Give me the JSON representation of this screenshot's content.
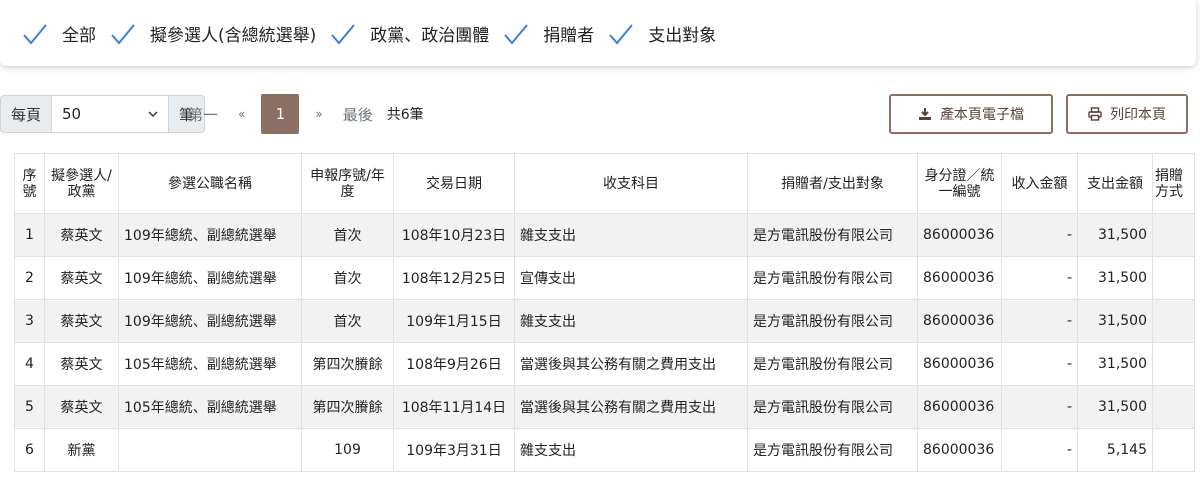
{
  "filters": [
    "全部",
    "擬參選人(含總統選舉)",
    "政黨、政治團體",
    "捐贈者",
    "支出對象"
  ],
  "toolbar": {
    "per_page_label": "每頁",
    "per_page_value": "50",
    "unit_label": "筆",
    "first": "第一",
    "prev": "«",
    "current_page": "1",
    "next": "»",
    "last": "最後",
    "total": "共6筆",
    "export_label": "產本頁電子檔",
    "print_label": "列印本頁"
  },
  "table": {
    "headers": [
      "序號",
      "擬參選人/政黨",
      "參選公職名稱",
      "申報序號/年度",
      "交易日期",
      "收支科目",
      "捐贈者/支出對象",
      "身分證／統一編號",
      "收入金額",
      "支出金額",
      "捐贈方式"
    ],
    "rows": [
      [
        "1",
        "蔡英文",
        "109年總統、副總統選舉",
        "首次",
        "108年10月23日",
        "雜支支出",
        "是方電訊股份有限公司",
        "86000036",
        "-",
        "31,500",
        ""
      ],
      [
        "2",
        "蔡英文",
        "109年總統、副總統選舉",
        "首次",
        "108年12月25日",
        "宣傳支出",
        "是方電訊股份有限公司",
        "86000036",
        "-",
        "31,500",
        ""
      ],
      [
        "3",
        "蔡英文",
        "109年總統、副總統選舉",
        "首次",
        "109年1月15日",
        "雜支支出",
        "是方電訊股份有限公司",
        "86000036",
        "-",
        "31,500",
        ""
      ],
      [
        "4",
        "蔡英文",
        "105年總統、副總統選舉",
        "第四次賸餘",
        "108年9月26日",
        "當選後與其公務有關之費用支出",
        "是方電訊股份有限公司",
        "86000036",
        "-",
        "31,500",
        ""
      ],
      [
        "5",
        "蔡英文",
        "105年總統、副總統選舉",
        "第四次賸餘",
        "108年11月14日",
        "當選後與其公務有關之費用支出",
        "是方電訊股份有限公司",
        "86000036",
        "-",
        "31,500",
        ""
      ],
      [
        "6",
        "新黨",
        "",
        "109",
        "109年3月31日",
        "雜支支出",
        "是方電訊股份有限公司",
        "86000036",
        "-",
        "5,145",
        ""
      ]
    ]
  },
  "colors": {
    "check": "#3b7ddd",
    "accent": "#8d6e63",
    "stripe": "#f2f2f2"
  }
}
